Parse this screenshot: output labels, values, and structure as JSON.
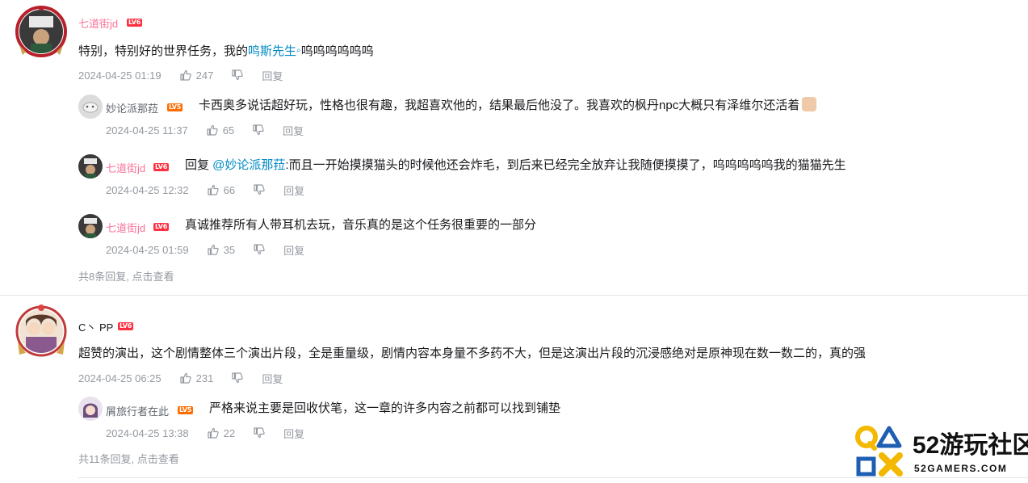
{
  "threads": [
    {
      "user": {
        "name": "七道街jd",
        "level": "LV6"
      },
      "content_prefix": "特别，特别好的世界任务，我的",
      "content_link": "鸣斯先生",
      "content_suffix": "呜呜呜呜呜呜",
      "time": "2024-04-25 01:19",
      "likes": "247",
      "reply_label": "回复",
      "replies": [
        {
          "user": {
            "name": "妙论派那菈",
            "level": "LV5"
          },
          "text": "卡西奥多说话超好玩，性格也很有趣，我超喜欢他的，结果最后他没了。我喜欢的枫丹npc大概只有泽维尔还活着",
          "time": "2024-04-25 11:37",
          "likes": "65",
          "reply_label": "回复"
        },
        {
          "user": {
            "name": "七道街jd",
            "level": "LV6"
          },
          "reply_prefix": "回复 ",
          "mention": "@妙论派那菈",
          "text": ":而且一开始摸摸猫头的时候他还会炸毛，到后来已经完全放弃让我随便摸摸了，呜呜呜呜呜我的猫猫先生",
          "time": "2024-04-25 12:32",
          "likes": "66",
          "reply_label": "回复"
        },
        {
          "user": {
            "name": "七道街jd",
            "level": "LV6"
          },
          "text": "真诚推荐所有人带耳机去玩，音乐真的是这个任务很重要的一部分",
          "time": "2024-04-25 01:59",
          "likes": "35",
          "reply_label": "回复"
        }
      ],
      "view_more": "共8条回复, 点击查看"
    },
    {
      "user": {
        "name": "C丶 PP",
        "level": "LV6"
      },
      "content": "超赞的演出，这个剧情整体三个演出片段，全是重量级，剧情内容本身量不多药不大，但是这演出片段的沉浸感绝对是原神现在数一数二的，真的强",
      "time": "2024-04-25 06:25",
      "likes": "231",
      "reply_label": "回复",
      "replies": [
        {
          "user": {
            "name": "屑旅行者在此",
            "level": "LV5"
          },
          "text": "严格来说主要是回收伏笔，这一章的许多内容之前都可以找到铺垫",
          "time": "2024-04-25 13:38",
          "likes": "22",
          "reply_label": "回复"
        }
      ],
      "view_more": "共11条回复, 点击查看"
    }
  ],
  "watermark": {
    "title": "52游玩社区",
    "subtitle": "52GAMERS.COM"
  },
  "colors": {
    "vip_name": "#fb7299",
    "link": "#008ac5",
    "meta": "#9499a0",
    "lv6": "#ff2f3f",
    "lv5": "#ff6c00",
    "wm_yellow": "#f5b800",
    "wm_blue": "#1e5fb3"
  },
  "icons": [
    "thumb-up-icon",
    "thumb-down-icon",
    "search-icon"
  ]
}
